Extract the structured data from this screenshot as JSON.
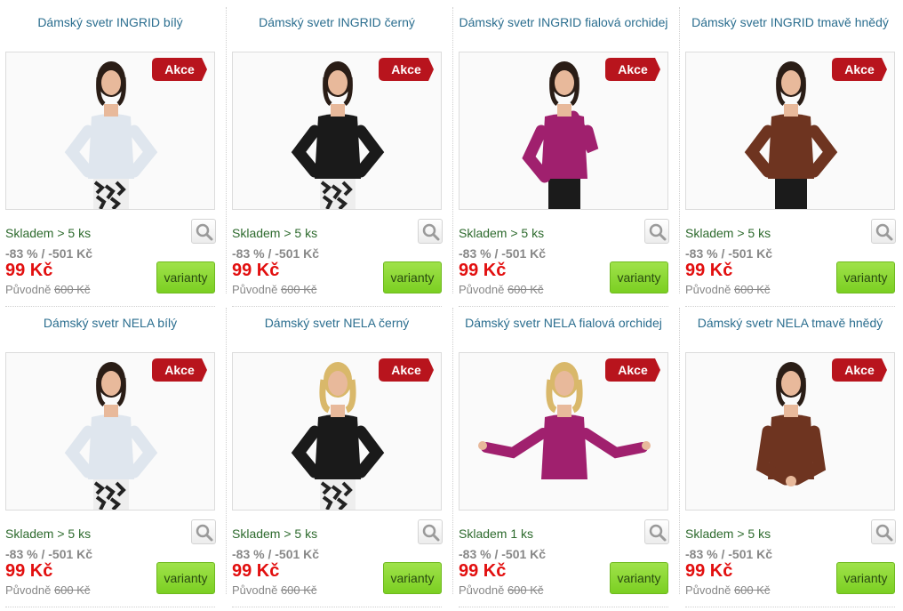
{
  "colors": {
    "title": "#2b6e8f",
    "stock": "#2d6a2d",
    "price": "#e20f0f",
    "badge": "#b8141d",
    "button": "#8fd93a"
  },
  "labels": {
    "badge": "Akce",
    "discount": "-83 % / -501 Kč",
    "price": "99 Kč",
    "original_prefix": "Původně",
    "original_price": "600 Kč",
    "variants_button": "varianty"
  },
  "products": [
    {
      "title": "Dámský svetr INGRID bílý",
      "stock": "Skladem > 5 ks",
      "sweater_color": "#dfe6ee",
      "hair": "dark",
      "pants": "pattern",
      "pose": "hips"
    },
    {
      "title": "Dámský svetr INGRID černý",
      "stock": "Skladem > 5 ks",
      "sweater_color": "#1a1a1a",
      "hair": "dark",
      "pants": "pattern",
      "pose": "hips"
    },
    {
      "title": "Dámský svetr INGRID fialová orchidej",
      "stock": "Skladem > 5 ks",
      "sweater_color": "#a0206e",
      "hair": "dark",
      "pants": "black",
      "pose": "side"
    },
    {
      "title": "Dámský svetr INGRID tmavě hnědý",
      "stock": "Skladem > 5 ks",
      "sweater_color": "#6e3420",
      "hair": "dark",
      "pants": "black",
      "pose": "hips"
    },
    {
      "title": "Dámský svetr NELA bílý",
      "stock": "Skladem > 5 ks",
      "sweater_color": "#dfe6ee",
      "hair": "dark",
      "pants": "pattern",
      "pose": "hips"
    },
    {
      "title": "Dámský svetr NELA černý",
      "stock": "Skladem > 5 ks",
      "sweater_color": "#1a1a1a",
      "hair": "blonde",
      "pants": "pattern",
      "pose": "hips"
    },
    {
      "title": "Dámský svetr NELA fialová orchidej",
      "stock": "Skladem 1 ks",
      "sweater_color": "#a0206e",
      "hair": "blonde",
      "pants": "none",
      "pose": "open"
    },
    {
      "title": "Dámský svetr NELA tmavě hnědý",
      "stock": "Skladem > 5 ks",
      "sweater_color": "#6e3420",
      "hair": "dark",
      "pants": "none",
      "pose": "clasped"
    }
  ]
}
